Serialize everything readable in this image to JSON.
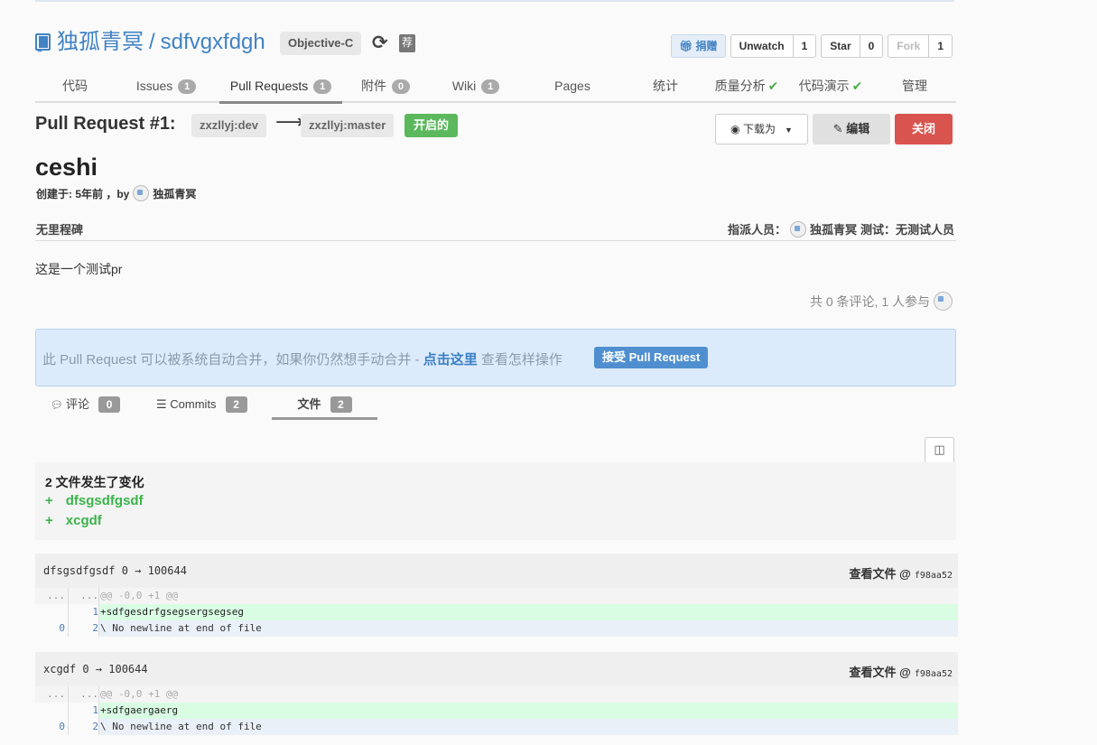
{
  "repo": {
    "owner": "独孤青冥",
    "name": "sdfvgxfdgh",
    "separator": "/",
    "language": "Objective-C",
    "recommend_label": "荐"
  },
  "actions": {
    "donate": "捐赠",
    "watch": {
      "label": "Unwatch",
      "count": "1"
    },
    "star": {
      "label": "Star",
      "count": "0"
    },
    "fork": {
      "label": "Fork",
      "count": "1"
    }
  },
  "nav": [
    {
      "label": "代码",
      "badge": null
    },
    {
      "label": "Issues",
      "badge": "1"
    },
    {
      "label": "Pull Requests",
      "badge": "1"
    },
    {
      "label": "附件",
      "badge": "0"
    },
    {
      "label": "Wiki",
      "badge": "1"
    },
    {
      "label": "Pages",
      "badge": null
    },
    {
      "label": "统计",
      "badge": null
    },
    {
      "label": "质量分析",
      "badge": null
    },
    {
      "label": "代码演示",
      "badge": null
    },
    {
      "label": "管理",
      "badge": null
    }
  ],
  "pr": {
    "title": "Pull Request #1:",
    "source_branch": "zxzllyj:dev",
    "target_branch": "zxzllyj:master",
    "arrow": "⟶",
    "state": "开启的",
    "download_label": "下载为",
    "edit_label": "编辑",
    "close_label": "关闭",
    "name": "ceshi",
    "created_prefix": "创建于: 5年前 ，by",
    "author": "独孤青冥",
    "milestone": "无里程碑",
    "assignee_prefix": "指派人员：",
    "assignee": "独孤青冥",
    "tester": "测试：无测试人员",
    "description": "这是一个测试pr",
    "comments_info": "共 0 条评论, 1 人参与"
  },
  "merge": {
    "text_before": "此 Pull Request 可以被系统自动合并，如果你仍然想手动合并 - ",
    "link": "点击这里",
    "text_after": " 查看怎样操作",
    "accept_label": "接受 Pull Request"
  },
  "sub_tabs": [
    {
      "icon": "comment-icon",
      "label": "评论",
      "count": "0"
    },
    {
      "icon": "list-icon",
      "label": "Commits",
      "count": "2"
    },
    {
      "icon": "",
      "label": "文件",
      "count": "2"
    }
  ],
  "changes": {
    "title": "2 文件发生了变化",
    "files": [
      "dfsgsdfgsdf",
      "xcgdf"
    ]
  },
  "diffs": [
    {
      "header": "dfsgsdfgsdf 0 → 100644",
      "view_label": "查看文件",
      "at": "@",
      "sha": "f98aa52",
      "rows": [
        {
          "type": "hunk",
          "ln1": "...",
          "ln2": "...",
          "code": "@@ -0,0 +1 @@"
        },
        {
          "type": "add",
          "ln1": "",
          "ln2": "1",
          "code": "+sdfgesdrfgsegsergsegseg"
        },
        {
          "type": "ctx",
          "ln1": "0",
          "ln2": "2",
          "code": "\\ No newline at end of file"
        }
      ]
    },
    {
      "header": "xcgdf 0 → 100644",
      "view_label": "查看文件",
      "at": "@",
      "sha": "f98aa52",
      "rows": [
        {
          "type": "hunk",
          "ln1": "...",
          "ln2": "...",
          "code": "@@ -0,0 +1 @@"
        },
        {
          "type": "add",
          "ln1": "",
          "ln2": "1",
          "code": "+sdfgaergaerg"
        },
        {
          "type": "ctx",
          "ln1": "0",
          "ln2": "2",
          "code": "\\ No newline at end of file"
        }
      ]
    }
  ]
}
